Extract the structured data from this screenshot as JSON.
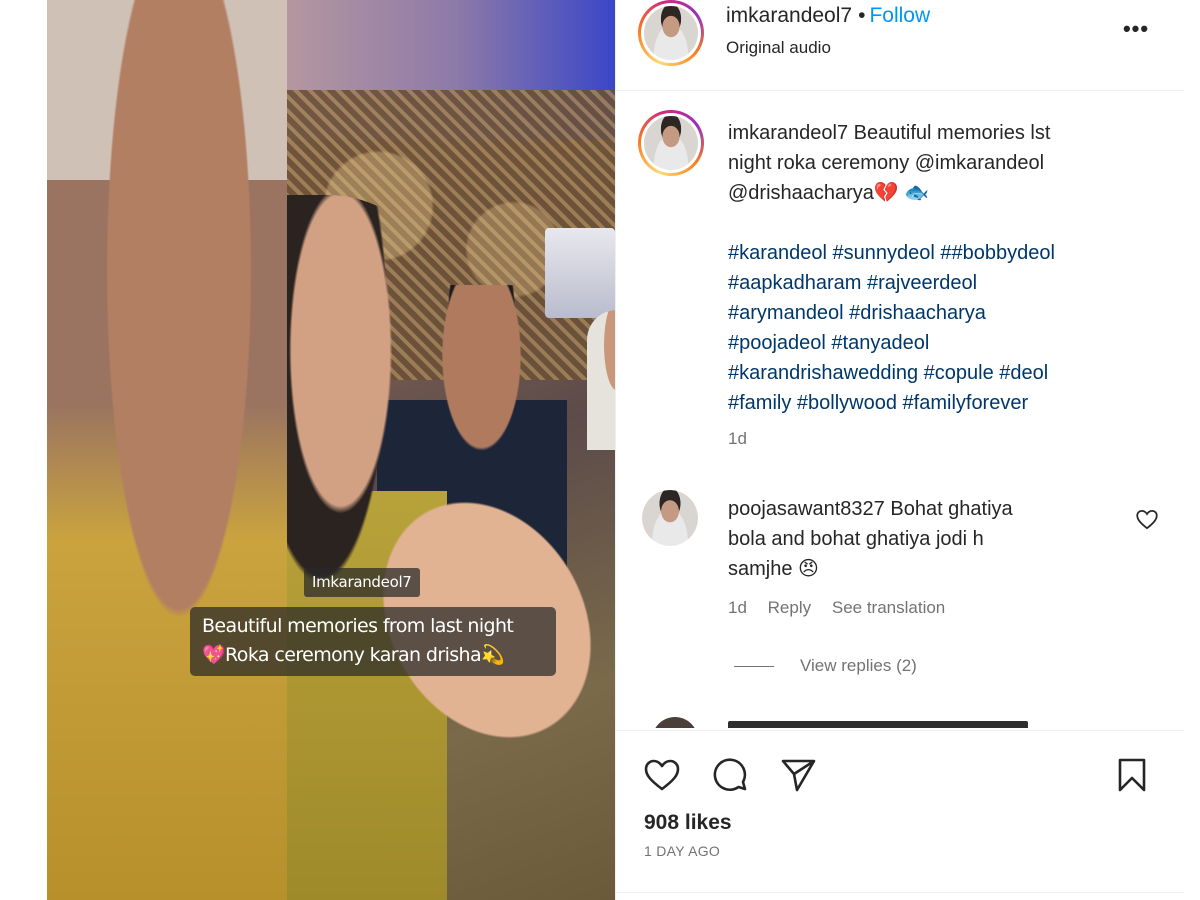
{
  "video": {
    "overlay_username": "Imkarandeol7",
    "overlay_caption_line1": "Beautiful memories from last night",
    "overlay_caption_line2": "💖Roka ceremony karan drisha💫"
  },
  "header": {
    "username": "imkarandeol7",
    "separator": "•",
    "follow_label": "Follow",
    "subtitle": "Original audio",
    "more_label": "•••"
  },
  "caption": {
    "username": "imkarandeol7",
    "line1": "Beautiful memories lst",
    "line2": "night roka ceremony @imkarandeol",
    "line3": "@drishaacharya💔 🐟",
    "hashtags": [
      "#karandeol #sunnydeol ##bobbydeol",
      "#aapkadharam #rajveerdeol",
      "#arymandeol #drishaacharya",
      "#poojadeol #tanyadeol",
      "#karandrishawedding #copule #deol",
      "#family #bollywood #familyforever"
    ],
    "time": "1d"
  },
  "comment": {
    "username": "poojasawant8327",
    "line1": "Bohat ghatiya",
    "line2": "bola and bohat ghatiya jodi h",
    "line3": "samjhe 😠",
    "time": "1d",
    "reply_label": "Reply",
    "translate_label": "See translation",
    "view_replies": "View replies (2)"
  },
  "actions": {
    "likes": "908 likes",
    "posted": "1 DAY AGO"
  },
  "colors": {
    "link": "#0095f6",
    "text": "#262626",
    "muted": "#737373",
    "border": "#efefef"
  }
}
